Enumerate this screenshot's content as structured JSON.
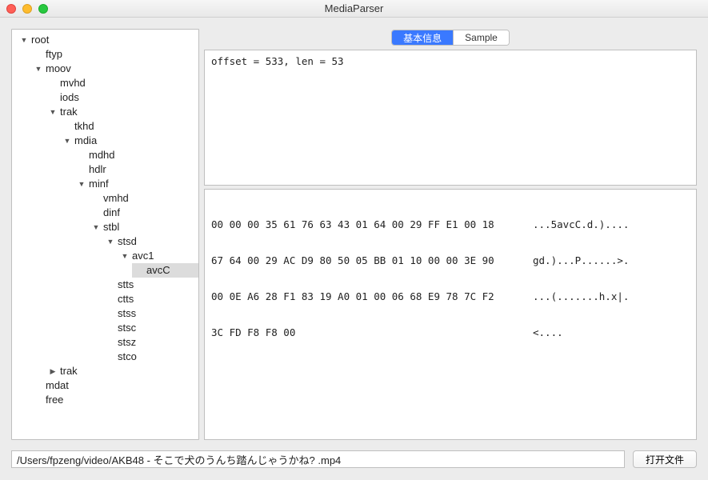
{
  "window": {
    "title": "MediaParser"
  },
  "tabs": {
    "basic": "基本信息",
    "sample": "Sample",
    "active": "basic"
  },
  "info": {
    "text": "offset = 533, len = 53"
  },
  "hex": [
    {
      "bytes": "00 00 00 35 61 76 63 43 01 64 00 29 FF E1 00 18",
      "ascii": "...5avcC.d.)...."
    },
    {
      "bytes": "67 64 00 29 AC D9 80 50 05 BB 01 10 00 00 3E 90",
      "ascii": "gd.)...P......>."
    },
    {
      "bytes": "00 0E A6 28 F1 83 19 A0 01 00 06 68 E9 78 7C F2",
      "ascii": "...(.......h.x|."
    },
    {
      "bytes": "3C FD F8 F8 00",
      "ascii": "<...."
    }
  ],
  "file": {
    "path": "/Users/fpzeng/video/AKB48 -  そこで犬のうんち踏んじゃうかね? .mp4"
  },
  "buttons": {
    "open": "打开文件"
  },
  "tree": {
    "root": "root",
    "ftyp": "ftyp",
    "moov": "moov",
    "mvhd": "mvhd",
    "iods": "iods",
    "trak": "trak",
    "tkhd": "tkhd",
    "mdia": "mdia",
    "mdhd": "mdhd",
    "hdlr": "hdlr",
    "minf": "minf",
    "vmhd": "vmhd",
    "dinf": "dinf",
    "stbl": "stbl",
    "stsd": "stsd",
    "avc1": "avc1",
    "avcC": "avcC",
    "stts": "stts",
    "ctts": "ctts",
    "stss": "stss",
    "stsc": "stsc",
    "stsz": "stsz",
    "stco": "stco",
    "trak2": "trak",
    "mdat": "mdat",
    "free": "free"
  }
}
